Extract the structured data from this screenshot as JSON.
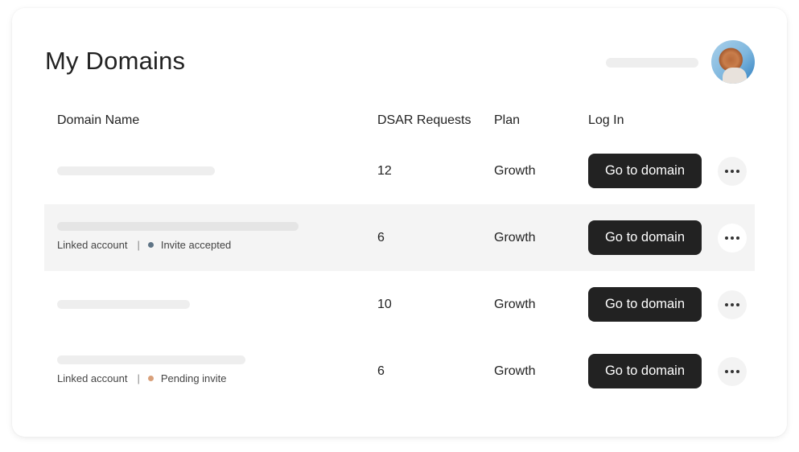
{
  "header": {
    "title": "My Domains",
    "avatar_alt": "user-avatar"
  },
  "table": {
    "columns": [
      "Domain Name",
      "DSAR Requests",
      "Plan",
      "Log In"
    ],
    "rows": [
      {
        "dsar": "12",
        "plan": "Growth",
        "button": "Go to domain",
        "linked": null,
        "status": null,
        "status_color": null,
        "highlighted": false
      },
      {
        "dsar": "6",
        "plan": "Growth",
        "button": "Go to domain",
        "linked": "Linked account",
        "status": "Invite accepted",
        "status_color": "#5f7486",
        "highlighted": true
      },
      {
        "dsar": "10",
        "plan": "Growth",
        "button": "Go to domain",
        "linked": null,
        "status": null,
        "status_color": null,
        "highlighted": false
      },
      {
        "dsar": "6",
        "plan": "Growth",
        "button": "Go to domain",
        "linked": "Linked account",
        "status": "Pending invite",
        "status_color": "#d9a07a",
        "highlighted": false
      }
    ]
  },
  "colors": {
    "button_bg": "#222222",
    "row_highlight": "#f4f4f4",
    "skeleton": "#eeeeee"
  }
}
